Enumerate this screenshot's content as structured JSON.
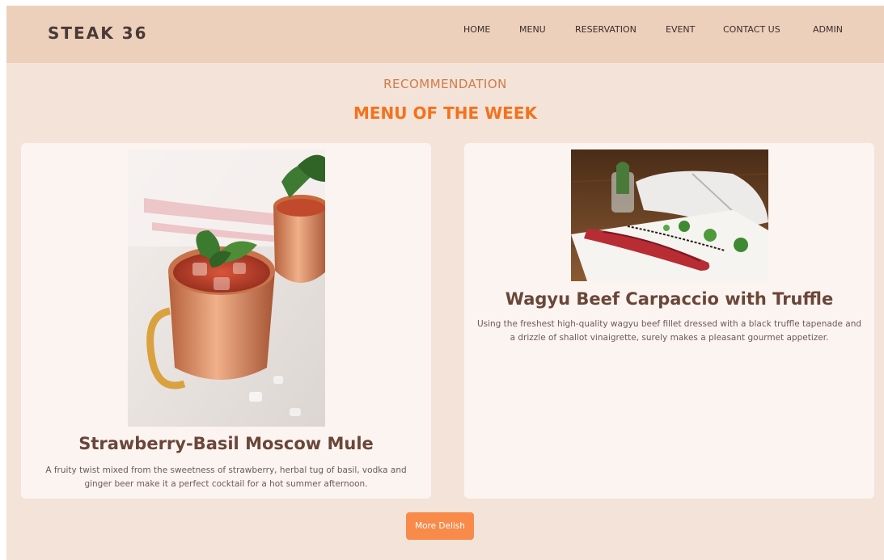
{
  "brand": {
    "name": "STEAK 36"
  },
  "nav": {
    "items": [
      {
        "label": "HOME"
      },
      {
        "label": "MENU"
      },
      {
        "label": "RESERVATION"
      },
      {
        "label": "EVENT"
      },
      {
        "label": "CONTACT US"
      },
      {
        "label": "ADMIN"
      }
    ]
  },
  "section": {
    "eyebrow": "RECOMMENDATION",
    "title": "MENU OF THE WEEK"
  },
  "cards": [
    {
      "title": "Strawberry-Basil Moscow Mule",
      "description": "A fruity twist mixed from the sweetness of strawberry, herbal tug of basil, vodka and ginger beer make it a perfect cocktail for a hot summer afternoon.",
      "image": "cocktail-photo"
    },
    {
      "title": "Wagyu Beef Carpaccio with Truffle",
      "description": "Using the freshest high-quality wagyu beef fillet dressed with a black truffle tapenade and a drizzle of shallot vinaigrette, surely makes a pleasant gourmet appetizer.",
      "image": "carpaccio-photo"
    }
  ],
  "cta": {
    "label": "More Delish"
  },
  "colors": {
    "navbar": "#ecd0bc",
    "background": "#f4e3d8",
    "accent": "#f4721c",
    "button": "#f88a4a",
    "card": "#fcf4f1"
  }
}
